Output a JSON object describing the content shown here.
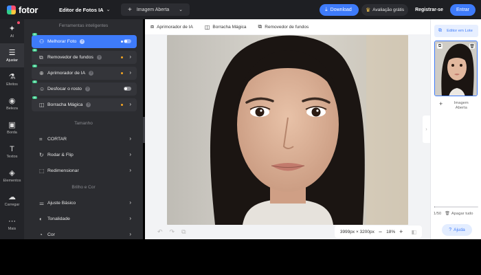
{
  "header": {
    "logo_text": "fotor",
    "app_selector": "Editor de Fotos IA",
    "open_image": "Imagem Aberta",
    "download": "Download",
    "free_trial": "Avaliação grátis",
    "register": "Registrar-se",
    "login": "Entrar"
  },
  "rail": {
    "items": [
      {
        "label": "AI",
        "icon": "magic-wand-icon",
        "glyph": "✦"
      },
      {
        "label": "Ajustar",
        "icon": "sliders-icon",
        "glyph": "⚙"
      },
      {
        "label": "Efeitos",
        "icon": "flask-icon",
        "glyph": "⚗"
      },
      {
        "label": "Beleza",
        "icon": "eye-icon",
        "glyph": "◉"
      },
      {
        "label": "Borda",
        "icon": "frame-icon",
        "glyph": "▣"
      },
      {
        "label": "Textos",
        "icon": "text-icon",
        "glyph": "T"
      },
      {
        "label": "Elementos",
        "icon": "shapes-icon",
        "glyph": "◈"
      },
      {
        "label": "Carregar",
        "icon": "cloud-upload-icon",
        "glyph": "☁"
      },
      {
        "label": "Mais",
        "icon": "more-icon",
        "glyph": "⋯"
      }
    ]
  },
  "panel": {
    "ai_section": "Ferramentas inteligentes",
    "ai_tools": [
      {
        "label": "Melhorar Foto",
        "glyph": "⚇"
      },
      {
        "label": "Removedor de fundos",
        "glyph": "⧉"
      },
      {
        "label": "Aprimorador de IA",
        "glyph": "⊕"
      },
      {
        "label": "Desfocar o rosto",
        "glyph": "☺"
      },
      {
        "label": "Borracha Mágica",
        "glyph": "◫"
      }
    ],
    "size_section": "Tamanho",
    "size_tools": [
      {
        "label": "CORTAR",
        "glyph": "⌗"
      },
      {
        "label": "Rodar & Flip",
        "glyph": "↻"
      },
      {
        "label": "Redimensionar",
        "glyph": "⬚"
      }
    ],
    "color_section": "Brilho e Cor",
    "color_tools": [
      {
        "label": "Ajuste Básico",
        "glyph": "⚌"
      },
      {
        "label": "Tonalidade",
        "glyph": "◐"
      },
      {
        "label": "Cor",
        "glyph": "◔"
      }
    ],
    "ai_badge": "AI"
  },
  "canvas": {
    "toolbar": [
      {
        "label": "Aprimorador de IA",
        "glyph": "⧈"
      },
      {
        "label": "Borracha Mágica",
        "glyph": "◫"
      },
      {
        "label": "Removedor de fundos",
        "glyph": "⧉"
      }
    ],
    "dimensions": "3999px × 3200px",
    "zoom": "18%",
    "zoom_minus": "−",
    "zoom_plus": "+"
  },
  "right_panel": {
    "batch_editor": "Editor em Lote",
    "add_image": "Imagem Aberta",
    "count": "1/50",
    "clear_all": "Apagar tudo",
    "help": "Ajuda",
    "progress": 0.02
  },
  "colors": {
    "accent": "#3e7bfa",
    "topbar": "#1e1f23",
    "panel": "#2b2c30"
  }
}
